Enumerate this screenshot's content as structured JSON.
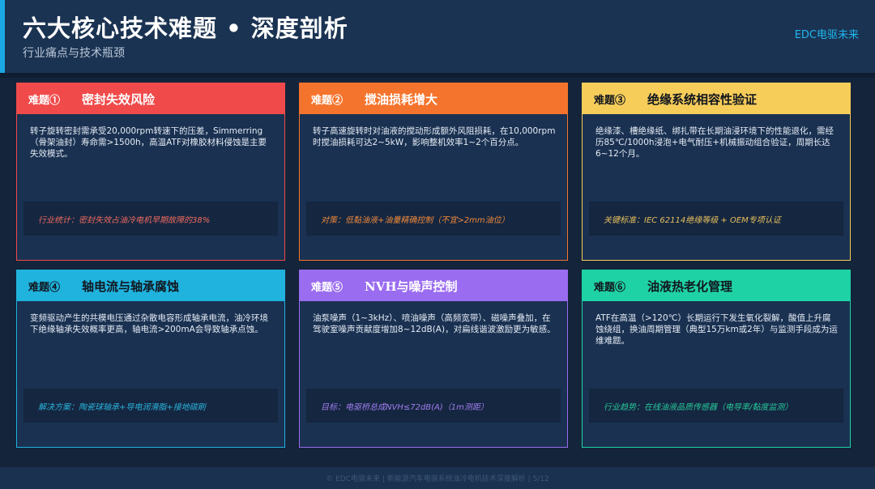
{
  "header": {
    "title": "六大核心技术难题 • 深度剖析",
    "subtitle": "行业痛点与技术瓶颈",
    "brand": "EDC电驱未来"
  },
  "cards": [
    {
      "num": "难题①",
      "title": "密封失效风险",
      "desc": "转子旋转密封需承受20,000rpm转速下的压差，Simmerring（骨架油封）寿命需>1500h，高温ATF对橡胶材料侵蚀是主要失效模式。",
      "note": "行业统计：密封失效占油冷电机早期故障的38%",
      "color": "#f04a4a",
      "note_color": "#f06b5f"
    },
    {
      "num": "难题②",
      "title": "搅油损耗增大",
      "desc": "转子高速旋转时对油液的搅动形成额外风阻损耗，在10,000rpm时搅油损耗可达2~5kW，影响整机效率1~2个百分点。",
      "note": "对策：低黏油液+油量精确控制（不宜>2mm油位）",
      "color": "#f5742d",
      "note_color": "#f08a3c"
    },
    {
      "num": "难题③",
      "title": "绝缘系统相容性验证",
      "desc": "绝缘漆、槽绝缘纸、绑扎带在长期油浸环境下的性能退化，需经历85℃/1000h浸泡+电气耐压+机械振动组合验证，周期长达6~12个月。",
      "note": "关键标准：IEC 62114绝缘等级 + OEM专项认证",
      "color": "#f7cd5a",
      "note_color": "#e9c05c"
    },
    {
      "num": "难题④",
      "title": "轴电流与轴承腐蚀",
      "desc": "变频驱动产生的共模电压通过杂散电容形成轴承电流，油冷环境下绝缘轴承失效概率更高，轴电流>200mA会导致轴承点蚀。",
      "note": "解决方案：陶瓷球轴承+导电润滑脂+接地碳刷",
      "color": "#1fb3de",
      "note_color": "#2ab4dc"
    },
    {
      "num": "难题⑤",
      "title": "NVH与噪声控制",
      "desc": "油泵噪声（1~3kHz）、喷油噪声（高频宽带）、磁噪声叠加，在驾驶室噪声贡献度增加8~12dB(A)，对扁线谐波激励更为敏感。",
      "note": "目标：电驱桥总成NVH≤72dB(A)（1m测距）",
      "color": "#9a6cf0",
      "note_color": "#a07ef0"
    },
    {
      "num": "难题⑥",
      "title": "油液热老化管理",
      "desc": "ATF在高温（>120℃）长期运行下发生氧化裂解，酸值上升腐蚀绕组，换油周期管理（典型15万km或2年）与监测手段成为运维难题。",
      "note": "行业趋势：在线油液品质传感器（电导率/黏度监测）",
      "color": "#1fd2a5",
      "note_color": "#27c89a"
    }
  ],
  "footer": "© EDC电驱未来 | 新能源汽车电驱系统油冷电机技术深度解析 | 5/12"
}
